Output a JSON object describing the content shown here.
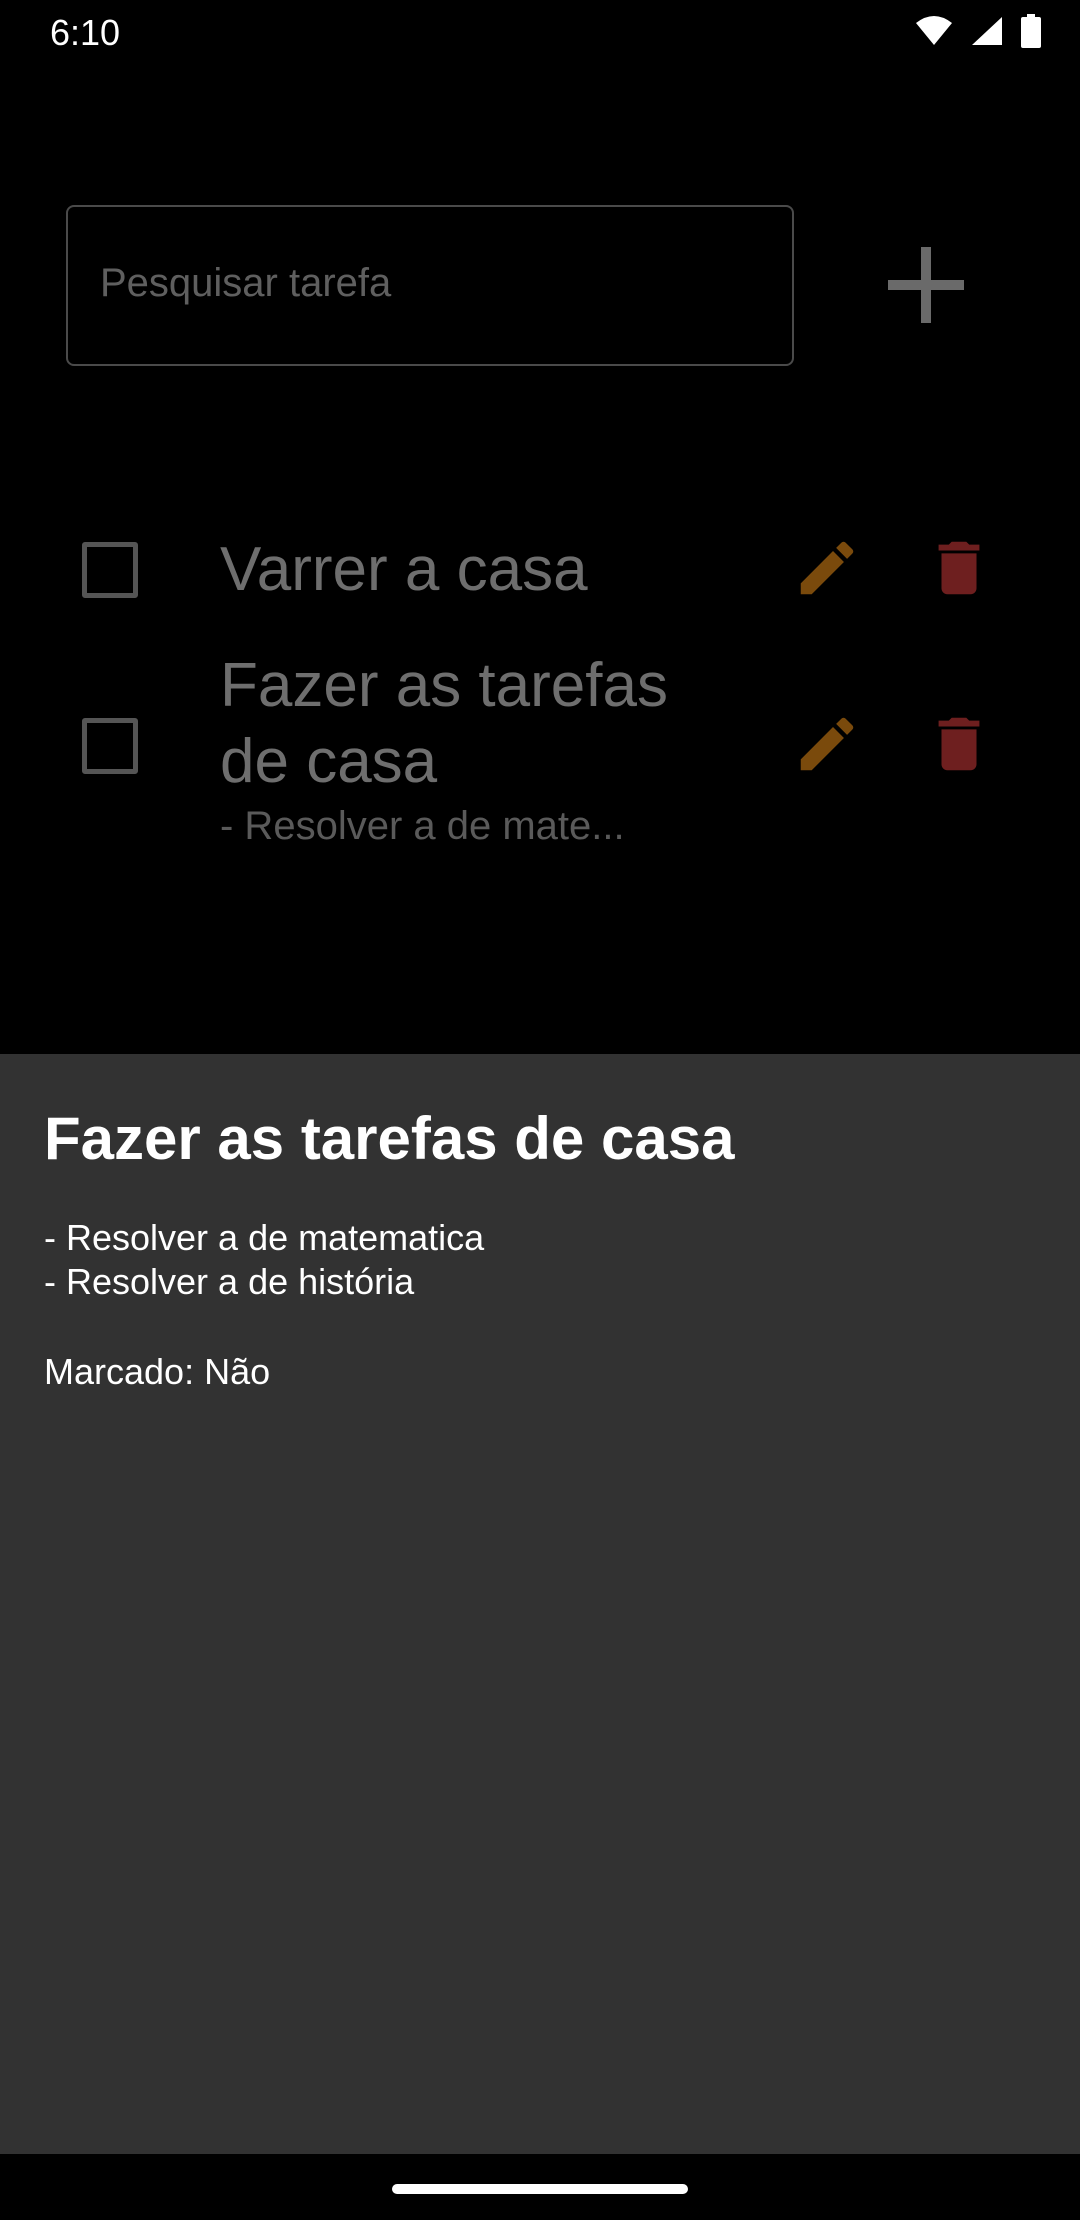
{
  "status_bar": {
    "time": "6:10",
    "icons": [
      "wifi-icon",
      "cellular-signal-icon",
      "battery-icon"
    ]
  },
  "search": {
    "placeholder": "Pesquisar tarefa"
  },
  "add_button": {
    "icon": "plus-icon"
  },
  "tasks": [
    {
      "title_lines": [
        "Varrer a casa"
      ],
      "subtitle": "",
      "checked": false
    },
    {
      "title_lines": [
        "Fazer as tarefas",
        "de casa"
      ],
      "subtitle": "- Resolver a de mate...",
      "checked": false
    }
  ],
  "sheet": {
    "title": "Fazer as tarefas de casa",
    "description": "- Resolver a de matematica\n- Resolver a de história",
    "status": "Marcado: Não"
  },
  "colors": {
    "background": "#000000",
    "sheet_background": "#323232",
    "edit_icon": "#7a4a0c",
    "delete_icon": "#6e1f1f",
    "dim_text": "#6e6e6e"
  }
}
